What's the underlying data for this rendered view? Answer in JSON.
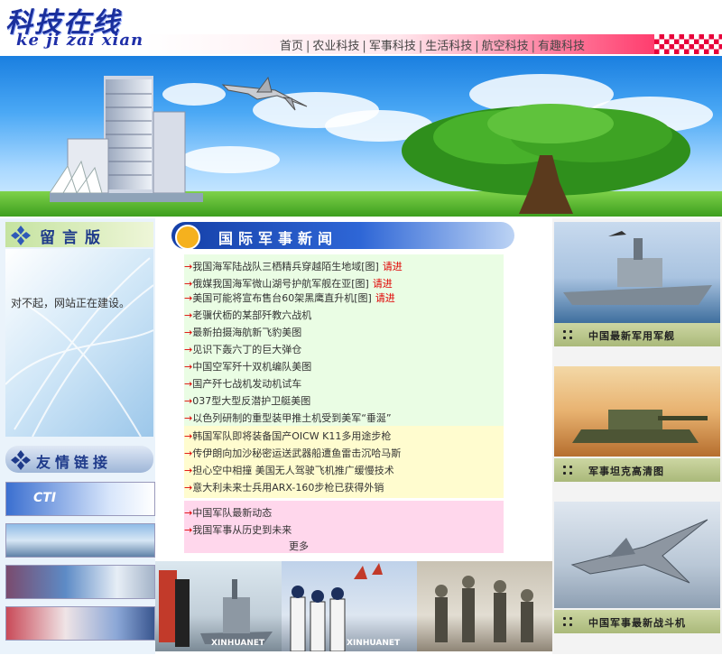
{
  "header": {
    "logo_cn": "科技在线",
    "logo_en": "ke ji zai xian"
  },
  "nav": {
    "items": [
      "首页",
      "农业科技",
      "军事科技",
      "生活科技",
      "航空科技",
      "有趣科技"
    ],
    "separator": "|"
  },
  "sidebar": {
    "guestbook_title": "留言版",
    "guestbook_message": "对不起，网站正在建设。",
    "links_title": "友情链接"
  },
  "news": {
    "section_title": "国际军事新闻",
    "arrow": "→",
    "request_label": "请进",
    "items": [
      {
        "text": "我国海军陆战队三栖精兵穿越陌生地域[图]",
        "request": "请进"
      },
      {
        "text": "俄媒我国海军微山湖号护航军舰在亚[图]",
        "request": "请进"
      },
      {
        "text": "美国可能将宣布售台60架黑鹰直升机[图]",
        "request": "请进"
      },
      {
        "text": "老骥伏枥的某部歼教六战机",
        "request": ""
      },
      {
        "text": "最新拍摄海航新飞豹美图",
        "request": ""
      },
      {
        "text": "见识下轰六丁的巨大弹仓",
        "request": ""
      },
      {
        "text": "中国空军歼十双机编队美图",
        "request": ""
      },
      {
        "text": "国产歼七战机发动机试车",
        "request": ""
      },
      {
        "text": "037型大型反潜护卫艇美图",
        "request": ""
      },
      {
        "text": "以色列研制的重型装甲推土机受到美军“垂涎”",
        "request": ""
      },
      {
        "text": "韩国军队即将装备国产OICW K11多用途步枪",
        "request": ""
      },
      {
        "text": "传伊朗向加沙秘密运送武器船遭鱼雷击沉哈马斯",
        "request": ""
      },
      {
        "text": "担心空中相撞 美国无人驾驶飞机推广缓慢技术",
        "request": ""
      },
      {
        "text": "意大利未来士兵用ARX-160步枪已获得外销",
        "request": ""
      },
      {
        "text": "中国军队最新动态",
        "request": ""
      },
      {
        "text": "我国军事从历史到未来",
        "request": ""
      }
    ],
    "more_label": "更多"
  },
  "right_panels": {
    "captions": [
      "中国最新军用军舰",
      "军事坦克高清图",
      "中国军事最新战斗机"
    ]
  },
  "photo_credit": "XINHUANET",
  "link_banner_cti": "CTI"
}
